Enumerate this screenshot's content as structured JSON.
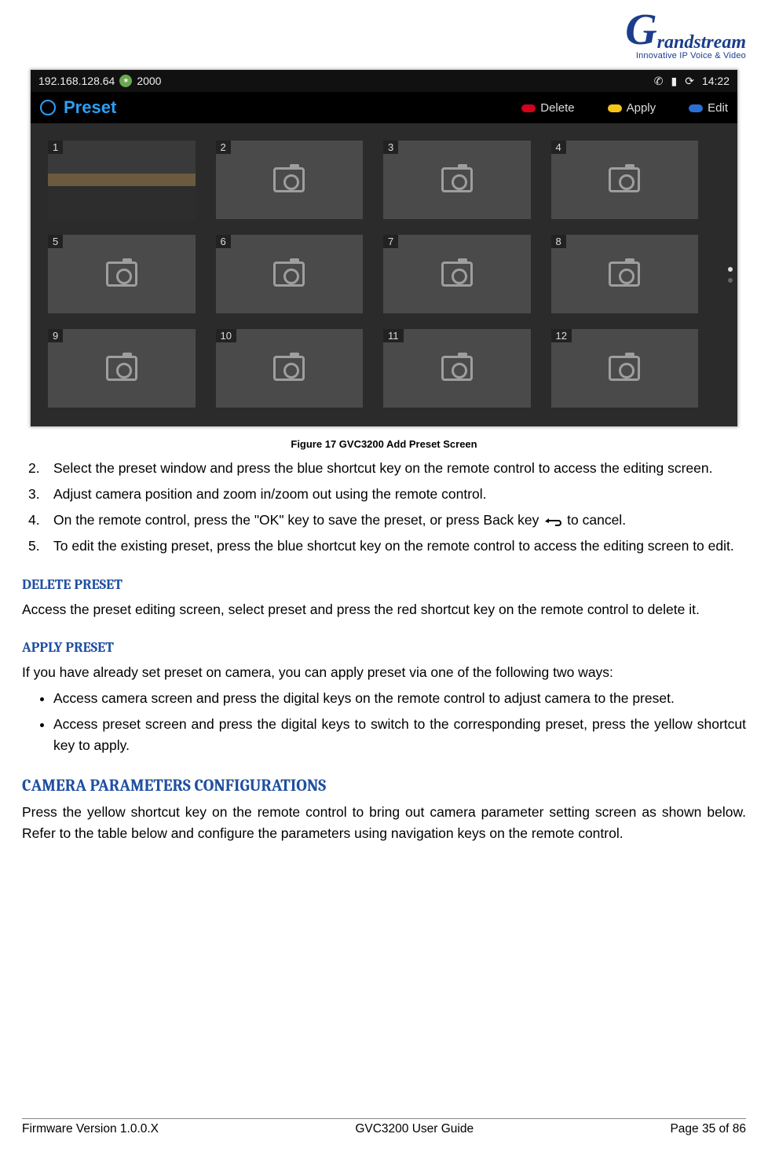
{
  "logo": {
    "brand": "randstream",
    "tagline": "Innovative IP Voice & Video"
  },
  "screenshot": {
    "status": {
      "ip": "192.168.128.64",
      "ext": "2000",
      "time": "14:22"
    },
    "title": "Preset",
    "actions": {
      "delete": "Delete",
      "apply": "Apply",
      "edit": "Edit"
    },
    "tiles": [
      "1",
      "2",
      "3",
      "4",
      "5",
      "6",
      "7",
      "8",
      "9",
      "10",
      "11",
      "12"
    ]
  },
  "caption": "Figure 17 GVC3200 Add Preset Screen",
  "steps": {
    "s2": "Select the preset window and press the blue shortcut key on the remote control to access the editing screen.",
    "s3": "Adjust camera position and zoom in/zoom out using the remote control.",
    "s4a": "On the remote control, press the \"OK\" key to save the preset, or press Back key",
    "s4b": "to cancel.",
    "s5": "To edit the existing preset, press the blue shortcut key on the remote control to access the editing screen to edit."
  },
  "sections": {
    "delete_preset_h": "DELETE PRESET",
    "delete_preset_p": "Access the preset editing screen, select preset and press the red shortcut key on the remote control to delete it.",
    "apply_preset_h": "APPLY PRESET",
    "apply_preset_p": "If you have already set preset on camera, you can apply preset via one of the following two ways:",
    "apply_b1": "Access camera screen and press the digital keys on the remote control to adjust camera to the preset.",
    "apply_b2": "Access preset screen and press the digital keys to switch to the corresponding preset, press the yellow shortcut key to apply.",
    "cam_params_h": "CAMERA PARAMETERS CONFIGURATIONS",
    "cam_params_p": "Press the yellow shortcut key on the remote control to bring out camera parameter setting screen as shown below. Refer to the table below and configure the parameters using navigation keys on the remote control."
  },
  "footer": {
    "left": "Firmware Version 1.0.0.X",
    "center": "GVC3200 User Guide",
    "right": "Page 35 of 86"
  }
}
